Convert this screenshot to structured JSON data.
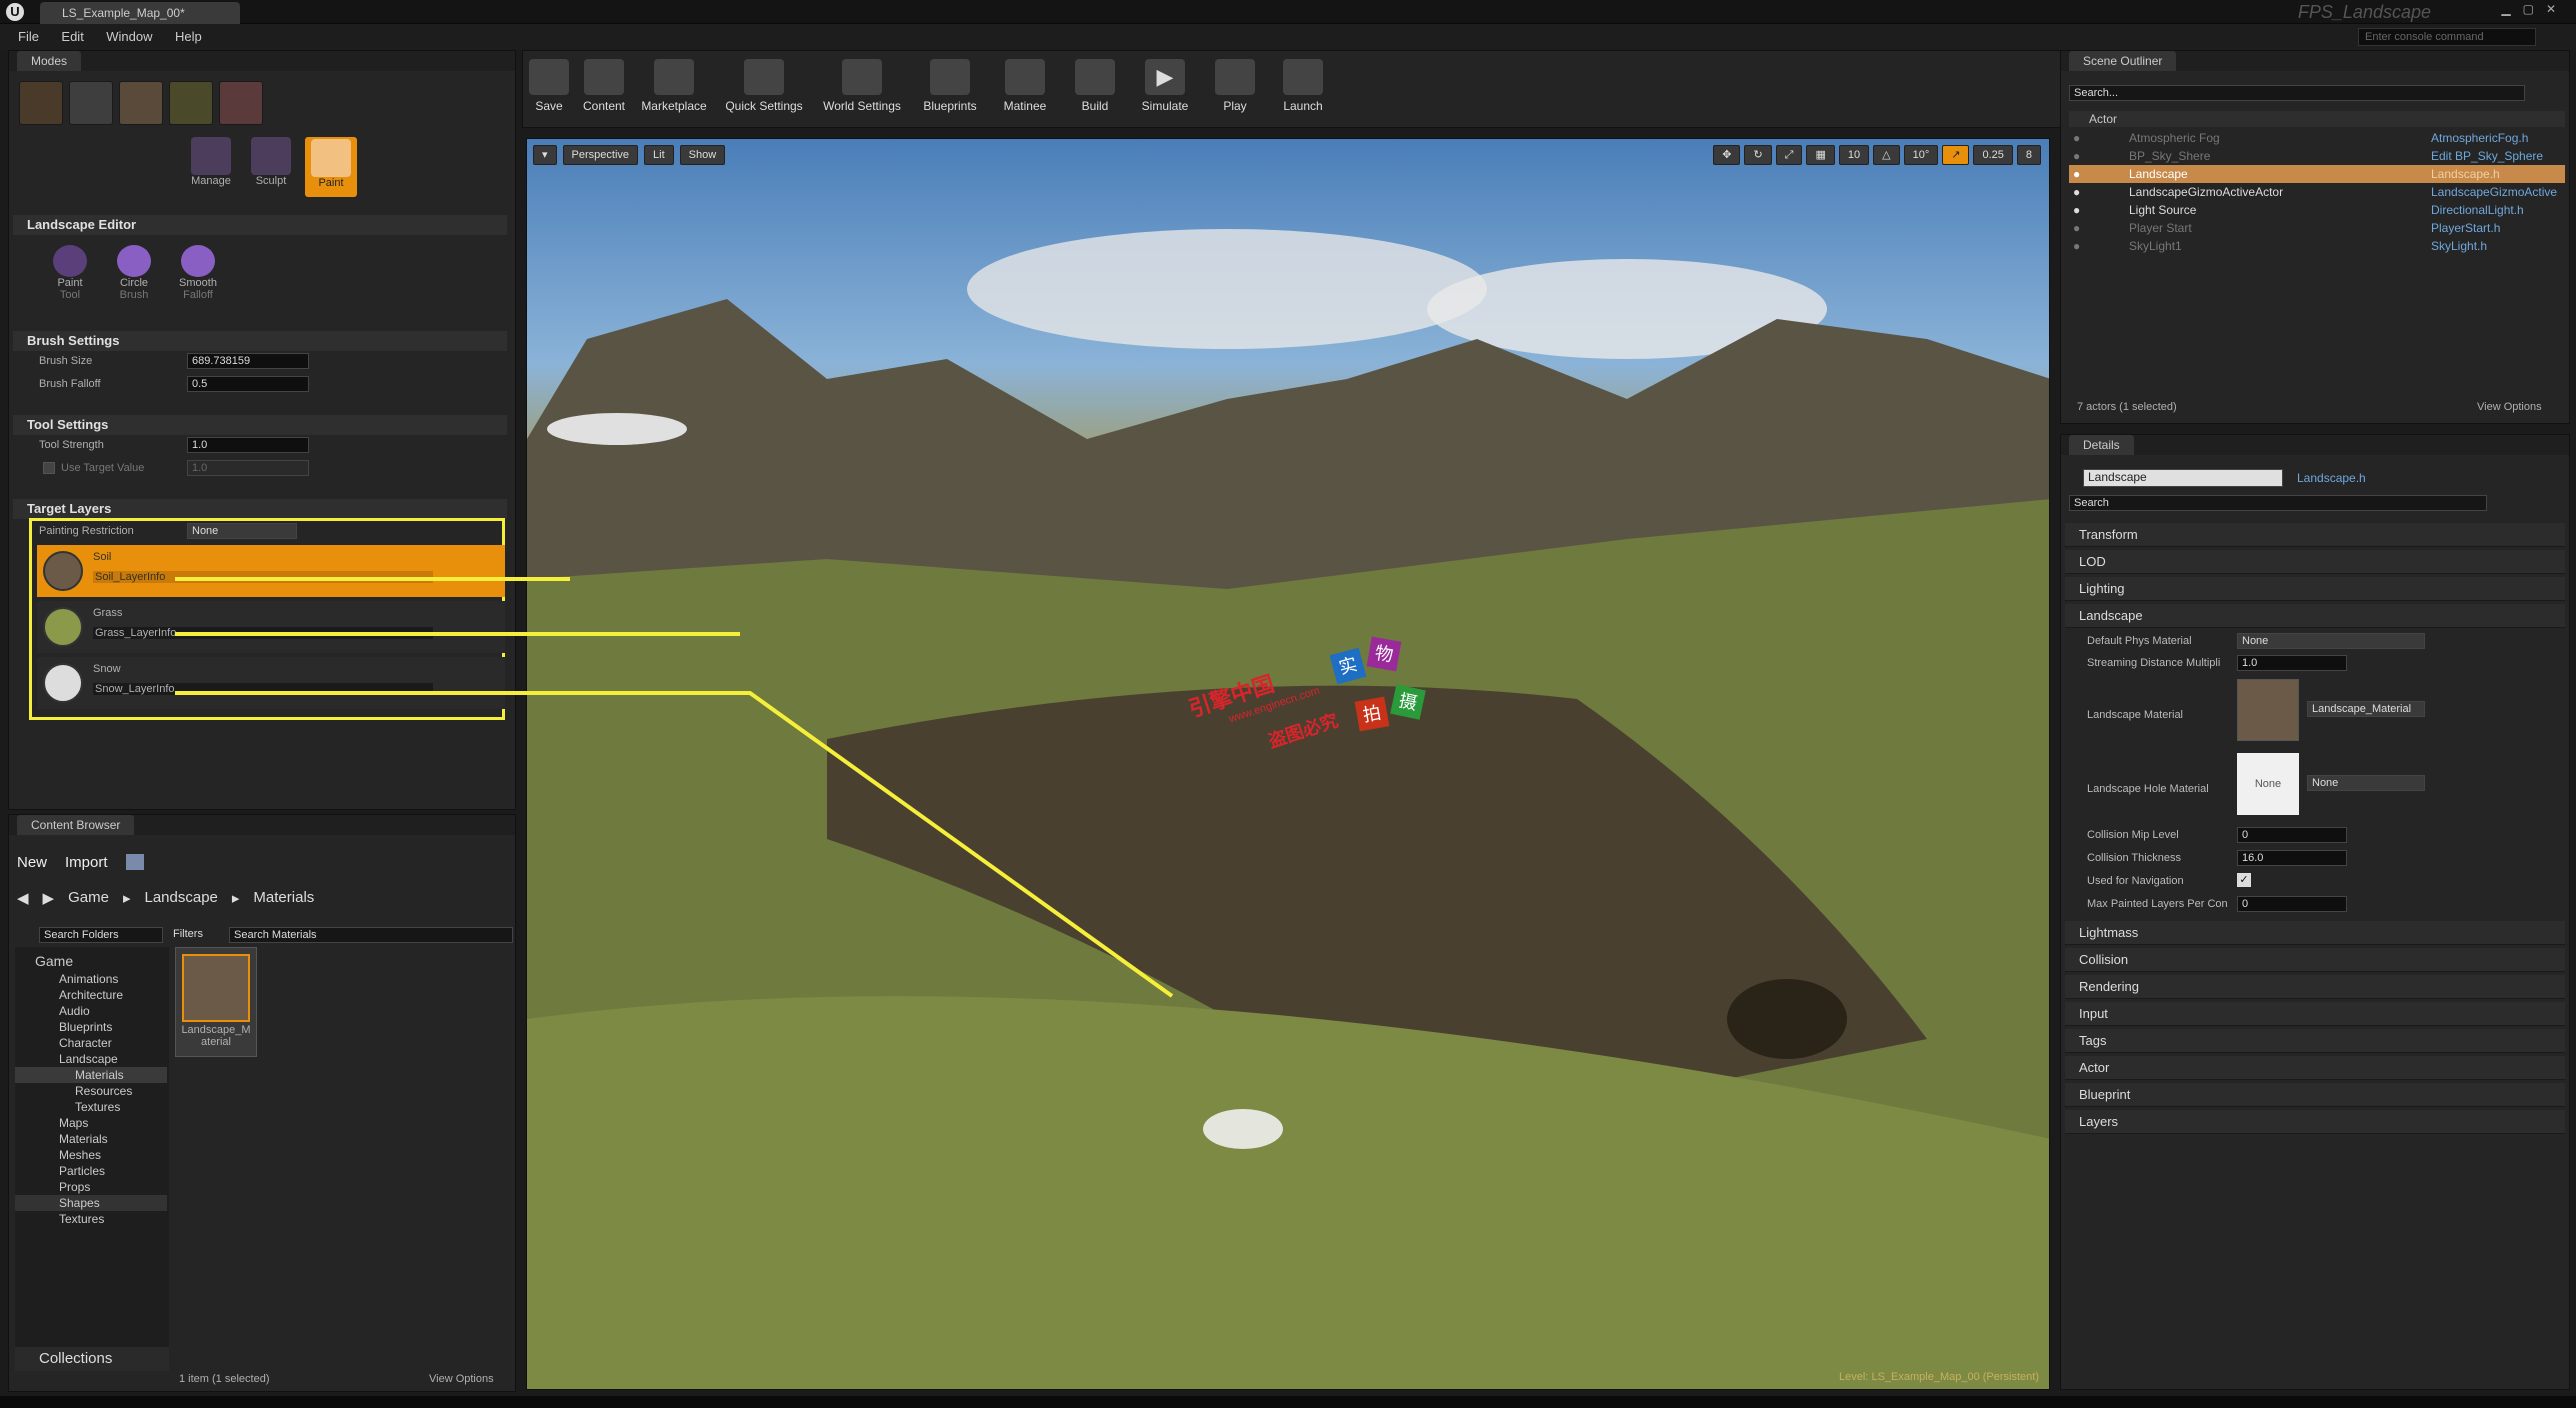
{
  "titlebar": {
    "tab": "LS_Example_Map_00*",
    "app_title": "FPS_Landscape",
    "console_placeholder": "Enter console command"
  },
  "menu": [
    "File",
    "Edit",
    "Window",
    "Help"
  ],
  "modes": {
    "tab": "Modes",
    "manage": "Manage",
    "sculpt": "Sculpt",
    "paint": "Paint"
  },
  "landscape_editor": {
    "title": "Landscape Editor",
    "tools": [
      {
        "l1": "Paint",
        "l2": "Tool"
      },
      {
        "l1": "Circle",
        "l2": "Brush"
      },
      {
        "l1": "Smooth",
        "l2": "Falloff"
      }
    ]
  },
  "brush": {
    "title": "Brush Settings",
    "size_label": "Brush Size",
    "size_value": "689.738159",
    "falloff_label": "Brush Falloff",
    "falloff_value": "0.5"
  },
  "tool": {
    "title": "Tool Settings",
    "strength_label": "Tool Strength",
    "strength_value": "1.0",
    "target_label": "Use Target Value",
    "target_value": "1.0"
  },
  "layers": {
    "title": "Target Layers",
    "restriction_label": "Painting Restriction",
    "restriction_value": "None",
    "items": [
      {
        "name": "Soil",
        "info": "Soil_LayerInfo"
      },
      {
        "name": "Grass",
        "info": "Grass_LayerInfo"
      },
      {
        "name": "Snow",
        "info": "Snow_LayerInfo"
      }
    ]
  },
  "content_browser": {
    "tab": "Content Browser",
    "new": "New",
    "import": "Import",
    "path": [
      "Game",
      "Landscape",
      "Materials"
    ],
    "search_folders": "Search Folders",
    "filters": "Filters",
    "search_materials": "Search Materials",
    "asset_l1": "Landscape_M",
    "asset_l2": "aterial",
    "folders": [
      "Game",
      "Animations",
      "Architecture",
      "Audio",
      "Blueprints",
      "Character",
      "Landscape",
      "Materials",
      "Resources",
      "Textures",
      "Maps",
      "Materials",
      "Meshes",
      "Particles",
      "Props",
      "Shapes",
      "Textures"
    ],
    "collections": "Collections",
    "status": "1 item (1 selected)",
    "view_options": "View Options"
  },
  "toolbar": [
    "Save",
    "Content",
    "Marketplace",
    "Quick Settings",
    "World Settings",
    "Blueprints",
    "Matinee",
    "Build",
    "Simulate",
    "Play",
    "Launch"
  ],
  "viewport": {
    "perspective": "Perspective",
    "lit": "Lit",
    "show": "Show",
    "snap": "10",
    "angle": "10°",
    "scale": "0.25",
    "speed": "8",
    "level": "Level:  LS_Example_Map_00 (Persistent)",
    "watermark": [
      "引擎中国",
      "www.enginecn.com",
      "盗图必究"
    ],
    "stamp": [
      "实",
      "物",
      "拍",
      "摄"
    ]
  },
  "outliner": {
    "tab": "Scene Outliner",
    "search": "Search...",
    "col_actor": "Actor",
    "rows": [
      {
        "label": "Atmospheric Fog",
        "type": "AtmosphericFog.h"
      },
      {
        "label": "BP_Sky_Shere",
        "type": "Edit BP_Sky_Sphere"
      },
      {
        "label": "Landscape",
        "type": "Landscape.h"
      },
      {
        "label": "LandscapeGizmoActiveActor",
        "type": "LandscapeGizmoActive"
      },
      {
        "label": "Light Source",
        "type": "DirectionalLight.h"
      },
      {
        "label": "Player Start",
        "type": "PlayerStart.h"
      },
      {
        "label": "SkyLight1",
        "type": "SkyLight.h"
      }
    ],
    "status": "7 actors (1 selected)",
    "view_options": "View Options"
  },
  "details": {
    "tab": "Details",
    "name": "Landscape",
    "class": "Landscape.h",
    "search": "Search",
    "sections_top": [
      "Transform",
      "LOD",
      "Lighting"
    ],
    "landscape_section": "Landscape",
    "props": {
      "phys_label": "Default Phys Material",
      "phys_value": "None",
      "stream_label": "Streaming Distance Multipli",
      "stream_value": "1.0",
      "mat_label": "Landscape Material",
      "mat_value": "Landscape_Material",
      "hole_label": "Landscape Hole Material",
      "hole_value": "None",
      "hole_thumb": "None",
      "mip_label": "Collision Mip Level",
      "mip_value": "0",
      "thick_label": "Collision Thickness",
      "thick_value": "16.0",
      "nav_label": "Used for Navigation",
      "maxlayers_label": "Max Painted Layers Per Con",
      "maxlayers_value": "0"
    },
    "sections_bottom": [
      "Lightmass",
      "Collision",
      "Rendering",
      "Input",
      "Tags",
      "Actor",
      "Blueprint",
      "Layers"
    ]
  },
  "colors": {
    "accent": "#e8900c",
    "highlight_yellow": "#f5ef3b",
    "selected_row": "#c88a4a"
  }
}
